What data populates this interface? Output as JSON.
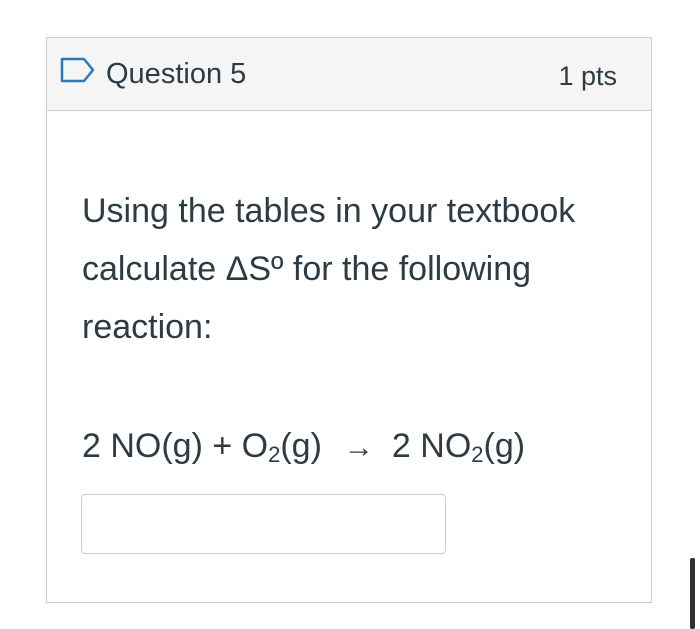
{
  "question": {
    "title": "Question 5",
    "points": "1 pts",
    "flag_icon": "bookmark-flag-icon",
    "text": "Using the tables in your textbook calculate ΔSº for the following reaction:",
    "equation": {
      "reactant1": "2 NO(g) + O",
      "reactant2_sub": "2",
      "reactant2_rest": "(g)",
      "arrow": "→",
      "product_pre": "2 NO",
      "product_sub": "2",
      "product_rest": "(g)"
    },
    "answer": {
      "value": "",
      "placeholder": ""
    }
  },
  "colors": {
    "text": "#2d3b45",
    "border": "#c7cdd1",
    "header_bg": "#f5f5f5",
    "flag": "#2b7abc"
  }
}
